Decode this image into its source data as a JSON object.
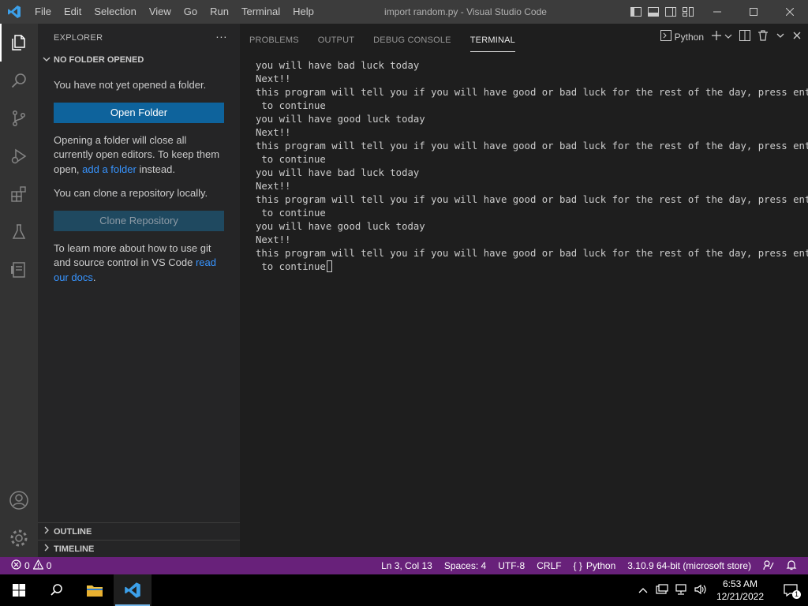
{
  "window": {
    "title": "import random.py - Visual Studio Code",
    "menu": [
      "File",
      "Edit",
      "Selection",
      "View",
      "Go",
      "Run",
      "Terminal",
      "Help"
    ]
  },
  "activity_bar": {
    "items": [
      "explorer-icon",
      "search-icon",
      "source-control-icon",
      "run-debug-icon",
      "extensions-icon",
      "testing-icon",
      "remote-icon"
    ],
    "bottom": [
      "account-icon",
      "manage-gear-icon"
    ]
  },
  "sidebar": {
    "header": "EXPLORER",
    "section_title": "NO FOLDER OPENED",
    "msg_not_opened": "You have not yet opened a folder.",
    "open_folder_button": "Open Folder",
    "msg_opening_1": "Opening a folder will close all currently open editors. To keep them open, ",
    "msg_opening_link": "add a folder",
    "msg_opening_2": " instead.",
    "msg_clone": "You can clone a repository locally.",
    "clone_button": "Clone Repository",
    "msg_learn_1": "To learn more about how to use git and source control in VS Code ",
    "msg_learn_link": "read our docs",
    "msg_learn_2": ".",
    "outline_title": "OUTLINE",
    "timeline_title": "TIMELINE"
  },
  "panel": {
    "tabs": [
      "PROBLEMS",
      "OUTPUT",
      "DEBUG CONSOLE",
      "TERMINAL"
    ],
    "active_tab": "TERMINAL",
    "terminal_profile": "Python",
    "terminal_lines": [
      "you will have bad luck today",
      "Next!!",
      "this program will tell you if you will have good or bad luck for the rest of the day, press enter",
      " to continue",
      "you will have good luck today",
      "Next!!",
      "this program will tell you if you will have good or bad luck for the rest of the day, press enter",
      " to continue",
      "you will have bad luck today",
      "Next!!",
      "this program will tell you if you will have good or bad luck for the rest of the day, press enter",
      " to continue",
      "you will have good luck today",
      "Next!!",
      "this program will tell you if you will have good or bad luck for the rest of the day, press enter",
      " to continue"
    ]
  },
  "statusbar": {
    "errors": "0",
    "warnings": "0",
    "position": "Ln 3, Col 13",
    "spaces": "Spaces: 4",
    "encoding": "UTF-8",
    "eol": "CRLF",
    "language": "Python",
    "interpreter": "3.10.9 64-bit (microsoft store)"
  },
  "taskbar": {
    "time": "6:53 AM",
    "date": "12/21/2022",
    "notification_count": "1"
  },
  "colors": {
    "statusbar": "#68217a",
    "accent": "#0e639c",
    "link": "#3794ff"
  }
}
